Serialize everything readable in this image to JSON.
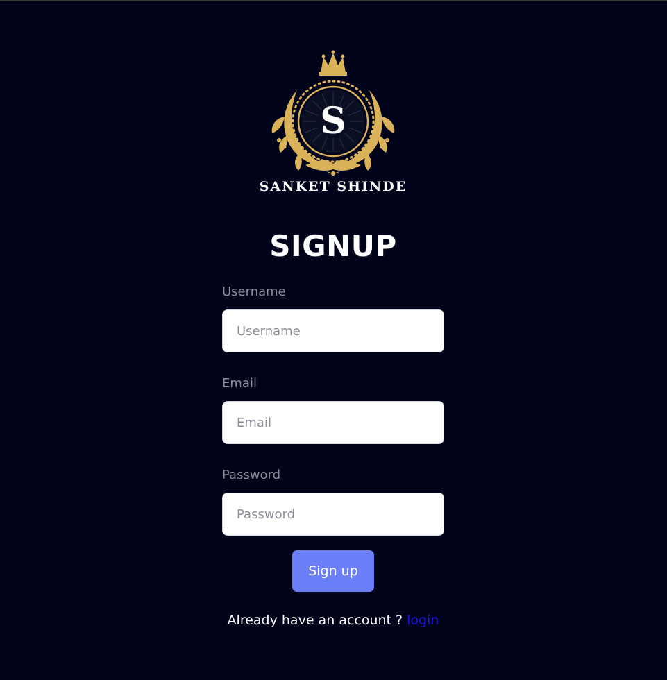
{
  "brand": {
    "logo_letter": "S",
    "name": "SANKET SHINDE",
    "gold_color": "#d9b25a"
  },
  "form": {
    "title": "SIGNUP",
    "username": {
      "label": "Username",
      "placeholder": "Username"
    },
    "email": {
      "label": "Email",
      "placeholder": "Email"
    },
    "password": {
      "label": "Password",
      "placeholder": "Password"
    },
    "submit_label": "Sign up"
  },
  "footer": {
    "prompt": "Already have an account ?",
    "login_label": "login"
  },
  "colors": {
    "background": "#00031a",
    "button": "#6b7ff8",
    "link": "#1a14e0"
  }
}
